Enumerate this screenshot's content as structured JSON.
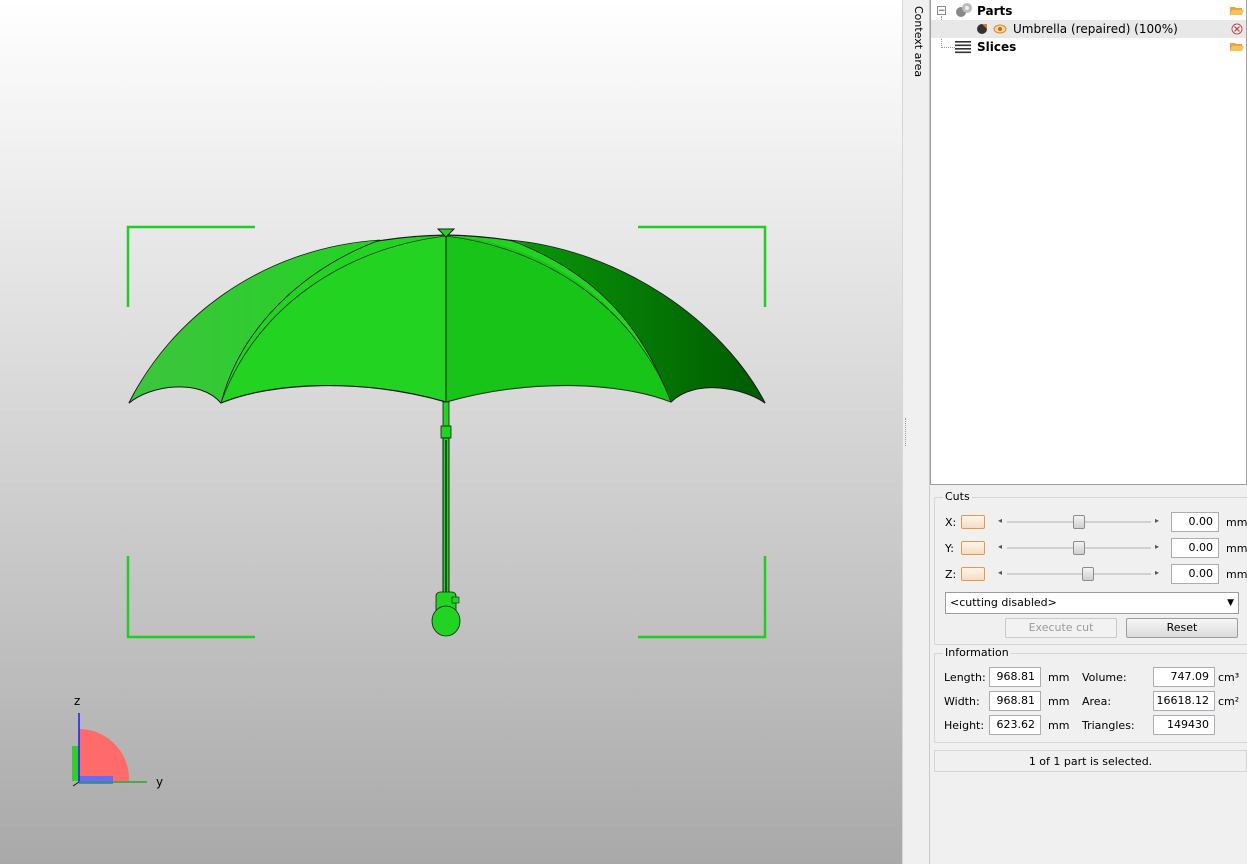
{
  "colors": {
    "model_green": "#22d322",
    "selection_frame": "#22cc22",
    "axis_z": "#1a1aff",
    "axis_y": "#22bb22",
    "axis_x": "#ff6666"
  },
  "viewport": {
    "axis_labels": {
      "z": "z",
      "y": "y"
    }
  },
  "context_tab": {
    "label": "Context area"
  },
  "tree": {
    "parts": {
      "label": "Parts",
      "icon": "parts-icon",
      "expander": "−"
    },
    "part_item": {
      "label": "Umbrella (repaired) (100%)"
    },
    "slices": {
      "label": "Slices",
      "icon": "slices-icon"
    }
  },
  "cuts": {
    "title": "Cuts",
    "rows": [
      {
        "axis": "X:",
        "value": "0.00",
        "unit": "mm",
        "slider_pos": 0.5
      },
      {
        "axis": "Y:",
        "value": "0.00",
        "unit": "mm",
        "slider_pos": 0.5
      },
      {
        "axis": "Z:",
        "value": "0.00",
        "unit": "mm",
        "slider_pos": 0.56
      }
    ],
    "mode": "<cutting disabled>",
    "execute_label": "Execute cut",
    "reset_label": "Reset"
  },
  "info": {
    "title": "Information",
    "length_label": "Length:",
    "length": "968.81",
    "length_unit": "mm",
    "width_label": "Width:",
    "width": "968.81",
    "width_unit": "mm",
    "height_label": "Height:",
    "height": "623.62",
    "height_unit": "mm",
    "volume_label": "Volume:",
    "volume": "747.09",
    "volume_unit": "cm³",
    "area_label": "Area:",
    "area": "16618.12",
    "area_unit": "cm²",
    "triangles_label": "Triangles:",
    "triangles": "149430"
  },
  "status": {
    "text": "1 of 1 part is selected."
  }
}
